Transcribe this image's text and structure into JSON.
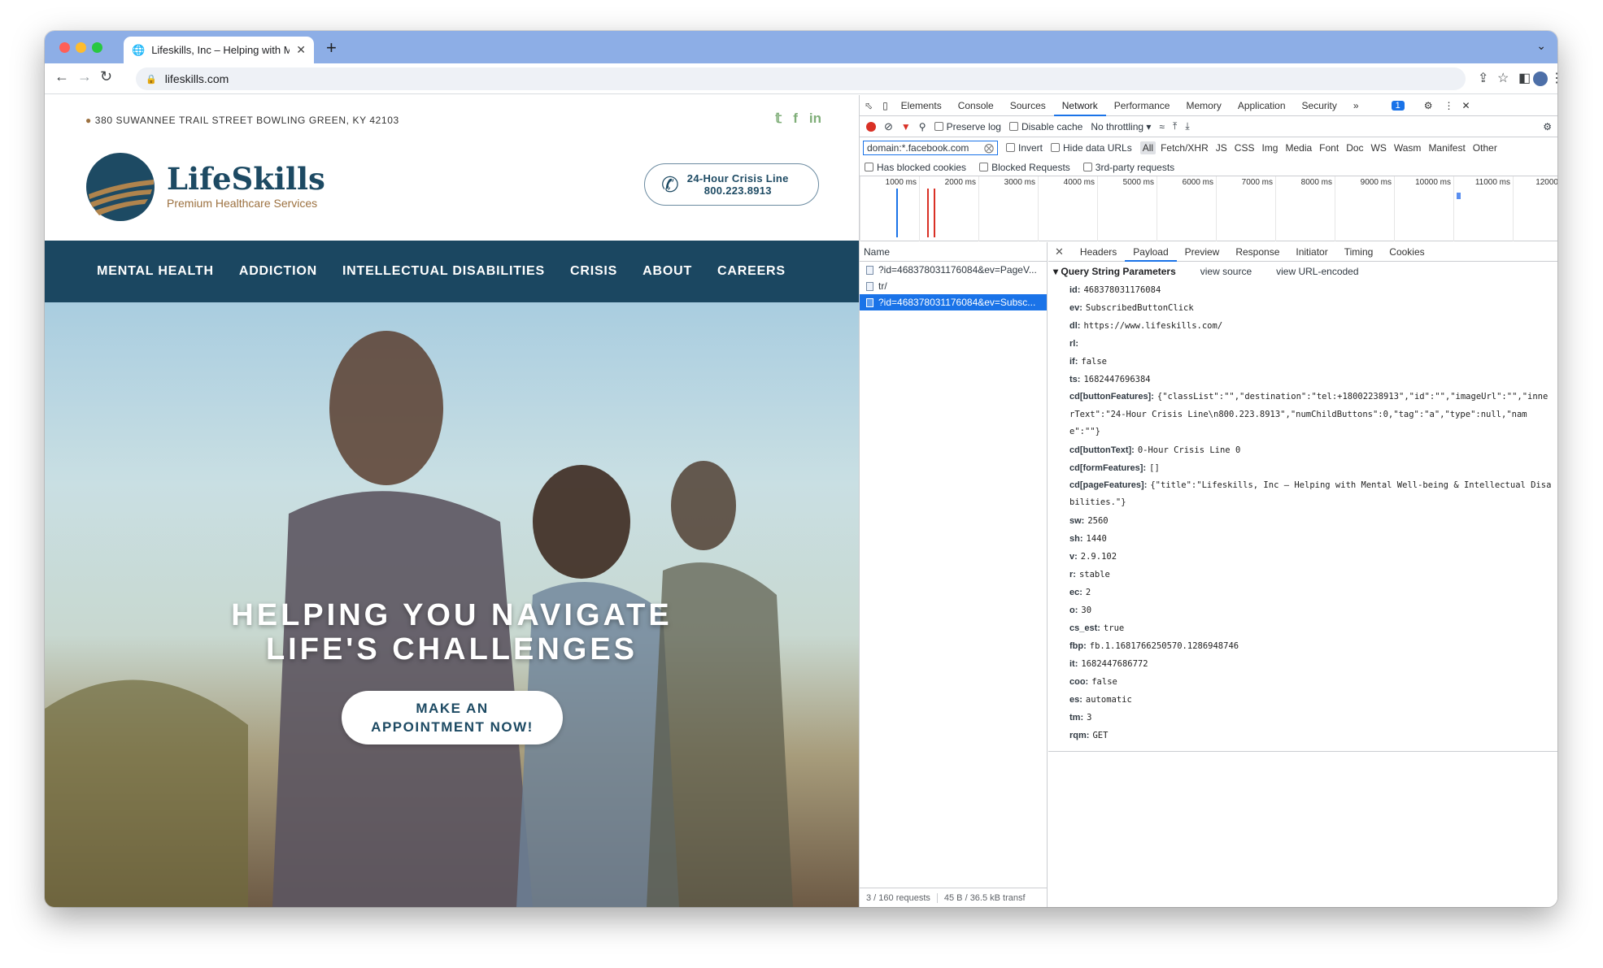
{
  "browser": {
    "tab_title": "Lifeskills, Inc – Helping with Mé",
    "url": "lifeskills.com"
  },
  "site": {
    "address": "380 SUWANNEE TRAIL STREET BOWLING GREEN, KY 42103",
    "brand": "LifeSkills",
    "tagline": "Premium Healthcare Services",
    "crisis_line_label": "24-Hour Crisis Line",
    "crisis_phone": "800.223.8913",
    "nav": [
      "MENTAL HEALTH",
      "ADDICTION",
      "INTELLECTUAL DISABILITIES",
      "CRISIS",
      "ABOUT",
      "CAREERS"
    ],
    "hero_line1": "HELPING YOU NAVIGATE",
    "hero_line2": "LIFE'S CHALLENGES",
    "cta_line1": "MAKE AN",
    "cta_line2": "APPOINTMENT NOW!"
  },
  "devtools": {
    "tabs": [
      "Elements",
      "Console",
      "Sources",
      "Network",
      "Performance",
      "Memory",
      "Application",
      "Security"
    ],
    "active_tab": "Network",
    "issues_count": "1",
    "preserve_log": "Preserve log",
    "disable_cache": "Disable cache",
    "throttling": "No throttling",
    "filter_value": "domain:*.facebook.com",
    "invert": "Invert",
    "hide_data_urls": "Hide data URLs",
    "filter_types": [
      "All",
      "Fetch/XHR",
      "JS",
      "CSS",
      "Img",
      "Media",
      "Font",
      "Doc",
      "WS",
      "Wasm",
      "Manifest",
      "Other"
    ],
    "blocked_cookies": "Has blocked cookies",
    "blocked_requests": "Blocked Requests",
    "third_party": "3rd-party requests",
    "timeline_ticks": [
      "1000 ms",
      "2000 ms",
      "3000 ms",
      "4000 ms",
      "5000 ms",
      "6000 ms",
      "7000 ms",
      "8000 ms",
      "9000 ms",
      "10000 ms",
      "11000 ms",
      "12000"
    ],
    "name_header": "Name",
    "requests": [
      "?id=468378031176084&ev=PageV...",
      "tr/",
      "?id=468378031176084&ev=Subsc..."
    ],
    "footer_requests": "3 / 160 requests",
    "footer_transfer": "45 B / 36.5 kB transf",
    "detail_tabs": [
      "Headers",
      "Payload",
      "Preview",
      "Response",
      "Initiator",
      "Timing",
      "Cookies"
    ],
    "qs_header": "Query String Parameters",
    "view_source": "view source",
    "view_url_encoded": "view URL-encoded",
    "params": [
      {
        "k": "id:",
        "v": "468378031176084"
      },
      {
        "k": "ev:",
        "v": "SubscribedButtonClick"
      },
      {
        "k": "dl:",
        "v": "https://www.lifeskills.com/"
      },
      {
        "k": "rl:",
        "v": ""
      },
      {
        "k": "if:",
        "v": "false"
      },
      {
        "k": "ts:",
        "v": "1682447696384"
      },
      {
        "k": "cd[buttonFeatures]:",
        "v": "{\"classList\":\"\",\"destination\":\"tel:+18002238913\",\"id\":\"\",\"imageUrl\":\"\",\"innerText\":\"24-Hour Crisis Line\\n800.223.8913\",\"numChildButtons\":0,\"tag\":\"a\",\"type\":null,\"name\":\"\"}"
      },
      {
        "k": "cd[buttonText]:",
        "v": "0-Hour Crisis Line 0"
      },
      {
        "k": "cd[formFeatures]:",
        "v": "[]"
      },
      {
        "k": "cd[pageFeatures]:",
        "v": "{\"title\":\"Lifeskills, Inc – Helping with Mental Well-being & Intellectual Disabilities.\"}"
      },
      {
        "k": "sw:",
        "v": "2560"
      },
      {
        "k": "sh:",
        "v": "1440"
      },
      {
        "k": "v:",
        "v": "2.9.102"
      },
      {
        "k": "r:",
        "v": "stable"
      },
      {
        "k": "ec:",
        "v": "2"
      },
      {
        "k": "o:",
        "v": "30"
      },
      {
        "k": "cs_est:",
        "v": "true"
      },
      {
        "k": "fbp:",
        "v": "fb.1.1681766250570.1286948746"
      },
      {
        "k": "it:",
        "v": "1682447686772"
      },
      {
        "k": "coo:",
        "v": "false"
      },
      {
        "k": "es:",
        "v": "automatic"
      },
      {
        "k": "tm:",
        "v": "3"
      },
      {
        "k": "rqm:",
        "v": "GET"
      }
    ]
  },
  "colors": {
    "nav_bg": "#1b4761",
    "brand": "#1d4a63",
    "accent_gold": "#9c7140",
    "devtools_select": "#1a73e8"
  }
}
